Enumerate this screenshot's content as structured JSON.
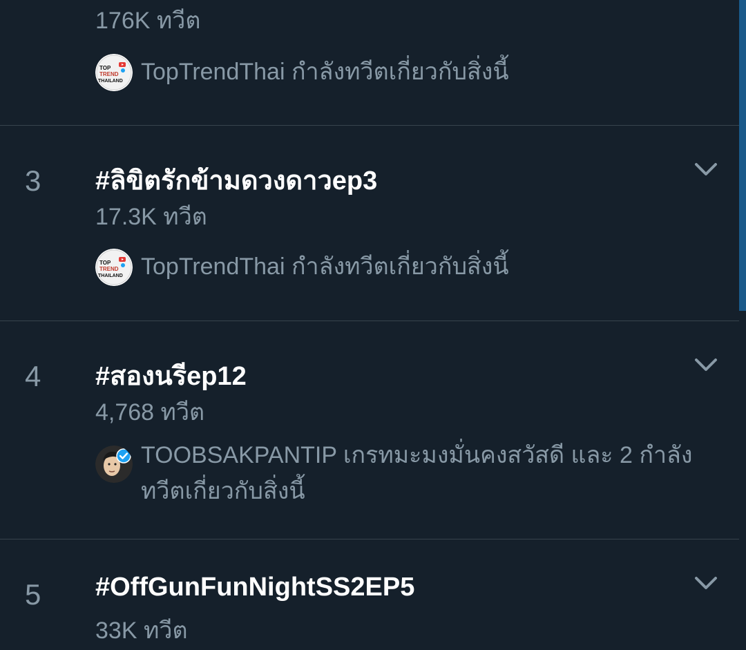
{
  "trends": [
    {
      "rank": "",
      "title": "",
      "count": "176K ทวีต",
      "context": "TopTrendThai กำลังทวีตเกี่ยวกับสิ่งนี้",
      "avatar": "toptrend-logo"
    },
    {
      "rank": "3",
      "title": "#ลิขิตรักข้ามดวงดาวep3",
      "count": "17.3K ทวีต",
      "context": "TopTrendThai กำลังทวีตเกี่ยวกับสิ่งนี้",
      "avatar": "toptrend-logo"
    },
    {
      "rank": "4",
      "title": "#สองนรีep12",
      "count": "4,768 ทวีต",
      "context": "TOOBSAKPANTIP เกรทมะมงมั่นคงสวัสดี และ 2 กำลังทวีตเกี่ยวกับสิ่งนี้",
      "avatar": "user-avatar-verified"
    },
    {
      "rank": "5",
      "title": "#OffGunFunNightSS2EP5",
      "count": "33K ทวีต",
      "context": "",
      "avatar": ""
    }
  ],
  "colors": {
    "background": "#15202b",
    "divider": "#38444d",
    "secondary_text": "#8899a6",
    "primary_text": "#ffffff",
    "verified": "#1da1f2",
    "scroll_thumb": "#1a5a8a"
  },
  "icons": {
    "chevron": "chevron-down-icon",
    "verified": "verified-badge-icon"
  }
}
